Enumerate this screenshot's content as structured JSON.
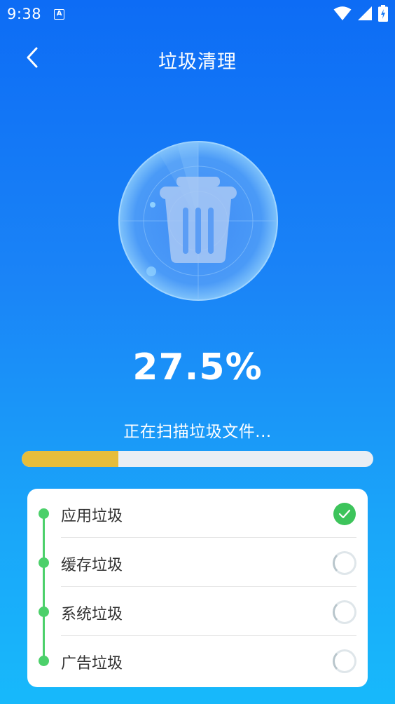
{
  "status_bar": {
    "time": "9:38",
    "notification_letter": "A"
  },
  "header": {
    "title": "垃圾清理"
  },
  "scan": {
    "percent_text": "27.5%",
    "progress_fraction": 0.275,
    "status_text": "正在扫描垃圾文件..."
  },
  "categories": [
    {
      "label": "应用垃圾",
      "state": "done"
    },
    {
      "label": "缓存垃圾",
      "state": "scanning"
    },
    {
      "label": "系统垃圾",
      "state": "scanning"
    },
    {
      "label": "广告垃圾",
      "state": "scanning"
    }
  ],
  "colors": {
    "accent_green": "#3dc45b",
    "progress_yellow": "#e6bd3c",
    "background_blue": "#1a84f7"
  }
}
